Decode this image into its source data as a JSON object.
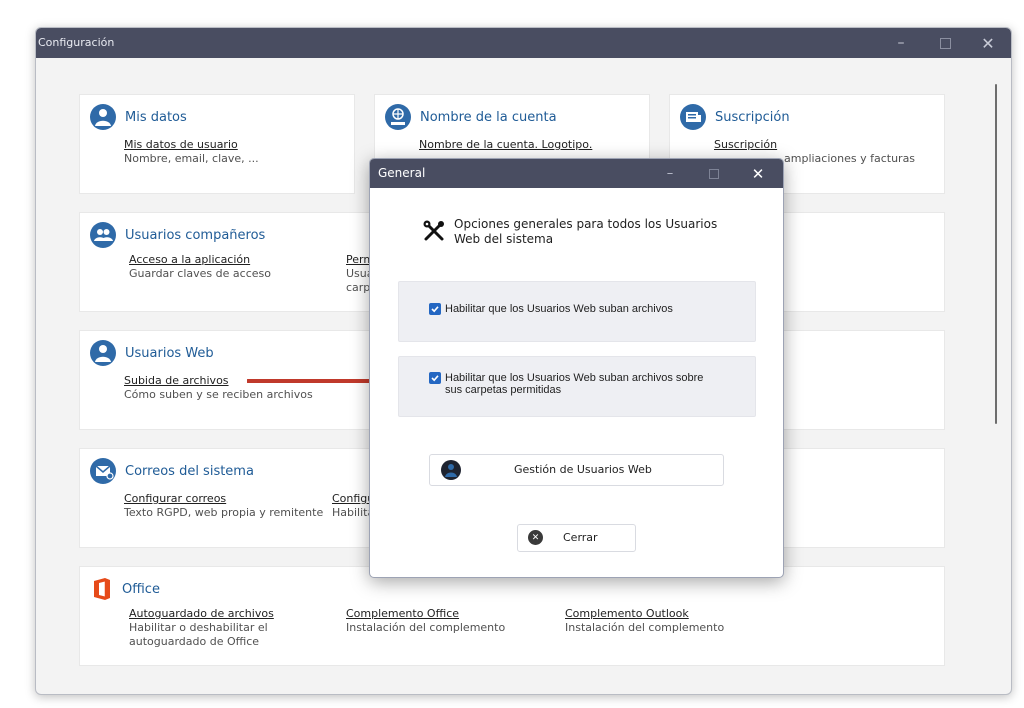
{
  "window": {
    "title": "Configuración",
    "controls": [
      "minimize",
      "maximize",
      "close"
    ]
  },
  "cards": {
    "mis_datos": {
      "title": "Mis datos",
      "icon": "user-circle-icon",
      "items": [
        {
          "link": "Mis datos de usuario",
          "desc": "Nombre, email, clave, ..."
        }
      ]
    },
    "nombre_cuenta": {
      "title": "Nombre de la cuenta",
      "icon": "globe-id-icon",
      "items": [
        {
          "link": "Nombre de la cuenta. Logotipo.",
          "desc": ""
        }
      ]
    },
    "suscripcion": {
      "title": "Suscripción",
      "icon": "subscription-icon",
      "items": [
        {
          "link": "Suscripción",
          "desc": "ampliaciones y facturas"
        }
      ]
    },
    "usuarios_companeros": {
      "title": "Usuarios compañeros",
      "icon": "users-group-icon",
      "items": [
        {
          "link": "Acceso a la aplicación",
          "desc": "Guardar claves de acceso"
        },
        {
          "link": "Perm",
          "desc": "Usua",
          "desc2": "carp"
        }
      ]
    },
    "usuarios_web": {
      "title": "Usuarios Web",
      "icon": "user-circle-icon",
      "items": [
        {
          "link": "Subida de archivos",
          "desc": "Cómo suben y se reciben archivos"
        }
      ]
    },
    "correos": {
      "title": "Correos del sistema",
      "icon": "mail-icon",
      "items": [
        {
          "link": "Configurar correos",
          "desc": "Texto RGPD, web propia y remitente"
        },
        {
          "link": "Configu",
          "desc": "Habilita"
        }
      ]
    },
    "office": {
      "title": "Office",
      "icon": "office-icon",
      "items": [
        {
          "link": "Autoguardado de archivos",
          "desc": "Habilitar o deshabilitar el",
          "desc2": "autoguardado de Office"
        },
        {
          "link": "Complemento Office",
          "desc": "Instalación del complemento"
        },
        {
          "link": "Complemento Outlook",
          "desc": "Instalación del complemento"
        }
      ]
    }
  },
  "dialog": {
    "title": "General",
    "header_icon": "tools-icon",
    "header_text": "Opciones generales para todos los Usuarios Web del sistema",
    "option1": {
      "label": "Habilitar que los Usuarios Web suban archivos",
      "checked": true
    },
    "option2": {
      "label_line1": "Habilitar que los Usuarios Web suban archivos sobre",
      "label_line2": "sus carpetas permitidas",
      "checked": true
    },
    "manage_button": "Gestión de Usuarios Web",
    "close_button": "Cerrar"
  },
  "colors": {
    "titlebar": "#494d61",
    "accent": "#2f6aa8",
    "checkbox": "#2467c2",
    "arrow": "#c0392b",
    "office": "#e64a19"
  }
}
